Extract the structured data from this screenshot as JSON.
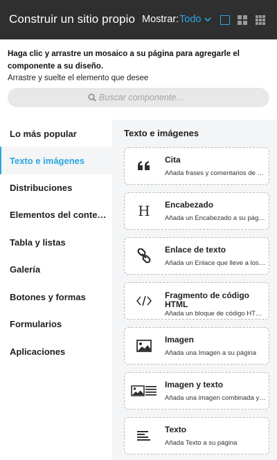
{
  "header": {
    "title": "Construir un sitio propio",
    "show_label": "Mostrar:",
    "show_value": "Todo",
    "accent_color": "#2aa6e0",
    "background_color": "#2f2f2f"
  },
  "instructions": {
    "bold": "Haga clic y arrastre un mosaico a su página para agregarle el componente a su diseño.",
    "sub": "Arrastre y suelte el elemento que desee"
  },
  "search": {
    "placeholder": "Buscar componente…"
  },
  "sidebar": {
    "items": [
      {
        "label": "Lo más popular",
        "active": false
      },
      {
        "label": "Texto e imágenes",
        "active": true
      },
      {
        "label": "Distribuciones",
        "active": false
      },
      {
        "label": "Elementos del conte…",
        "active": false
      },
      {
        "label": "Tabla y listas",
        "active": false
      },
      {
        "label": "Galería",
        "active": false
      },
      {
        "label": "Botones y formas",
        "active": false
      },
      {
        "label": "Formularios",
        "active": false
      },
      {
        "label": "Aplicaciones",
        "active": false
      }
    ]
  },
  "content": {
    "section_title": "Texto e imágenes",
    "cards": [
      {
        "icon": "quote-icon",
        "title": "Cita",
        "desc": "Añada frases y comentarios de …"
      },
      {
        "icon": "heading-icon",
        "title": "Encabezado",
        "desc": "Añada un Encabezado a su página"
      },
      {
        "icon": "link-icon",
        "title": "Enlace de texto",
        "desc": "Añada un Enlace que lleve a los …"
      },
      {
        "icon": "code-icon",
        "title": "Fragmento de código HTML",
        "desc": "Añada un bloque de código HT…"
      },
      {
        "icon": "image-icon",
        "title": "Imagen",
        "desc": "Añada una Imagen a su página"
      },
      {
        "icon": "image-text-icon",
        "title": "Imagen y texto",
        "desc": "Añada una imagen combinada y …"
      },
      {
        "icon": "text-icon",
        "title": "Texto",
        "desc": "Añada Texto a su página"
      }
    ]
  }
}
